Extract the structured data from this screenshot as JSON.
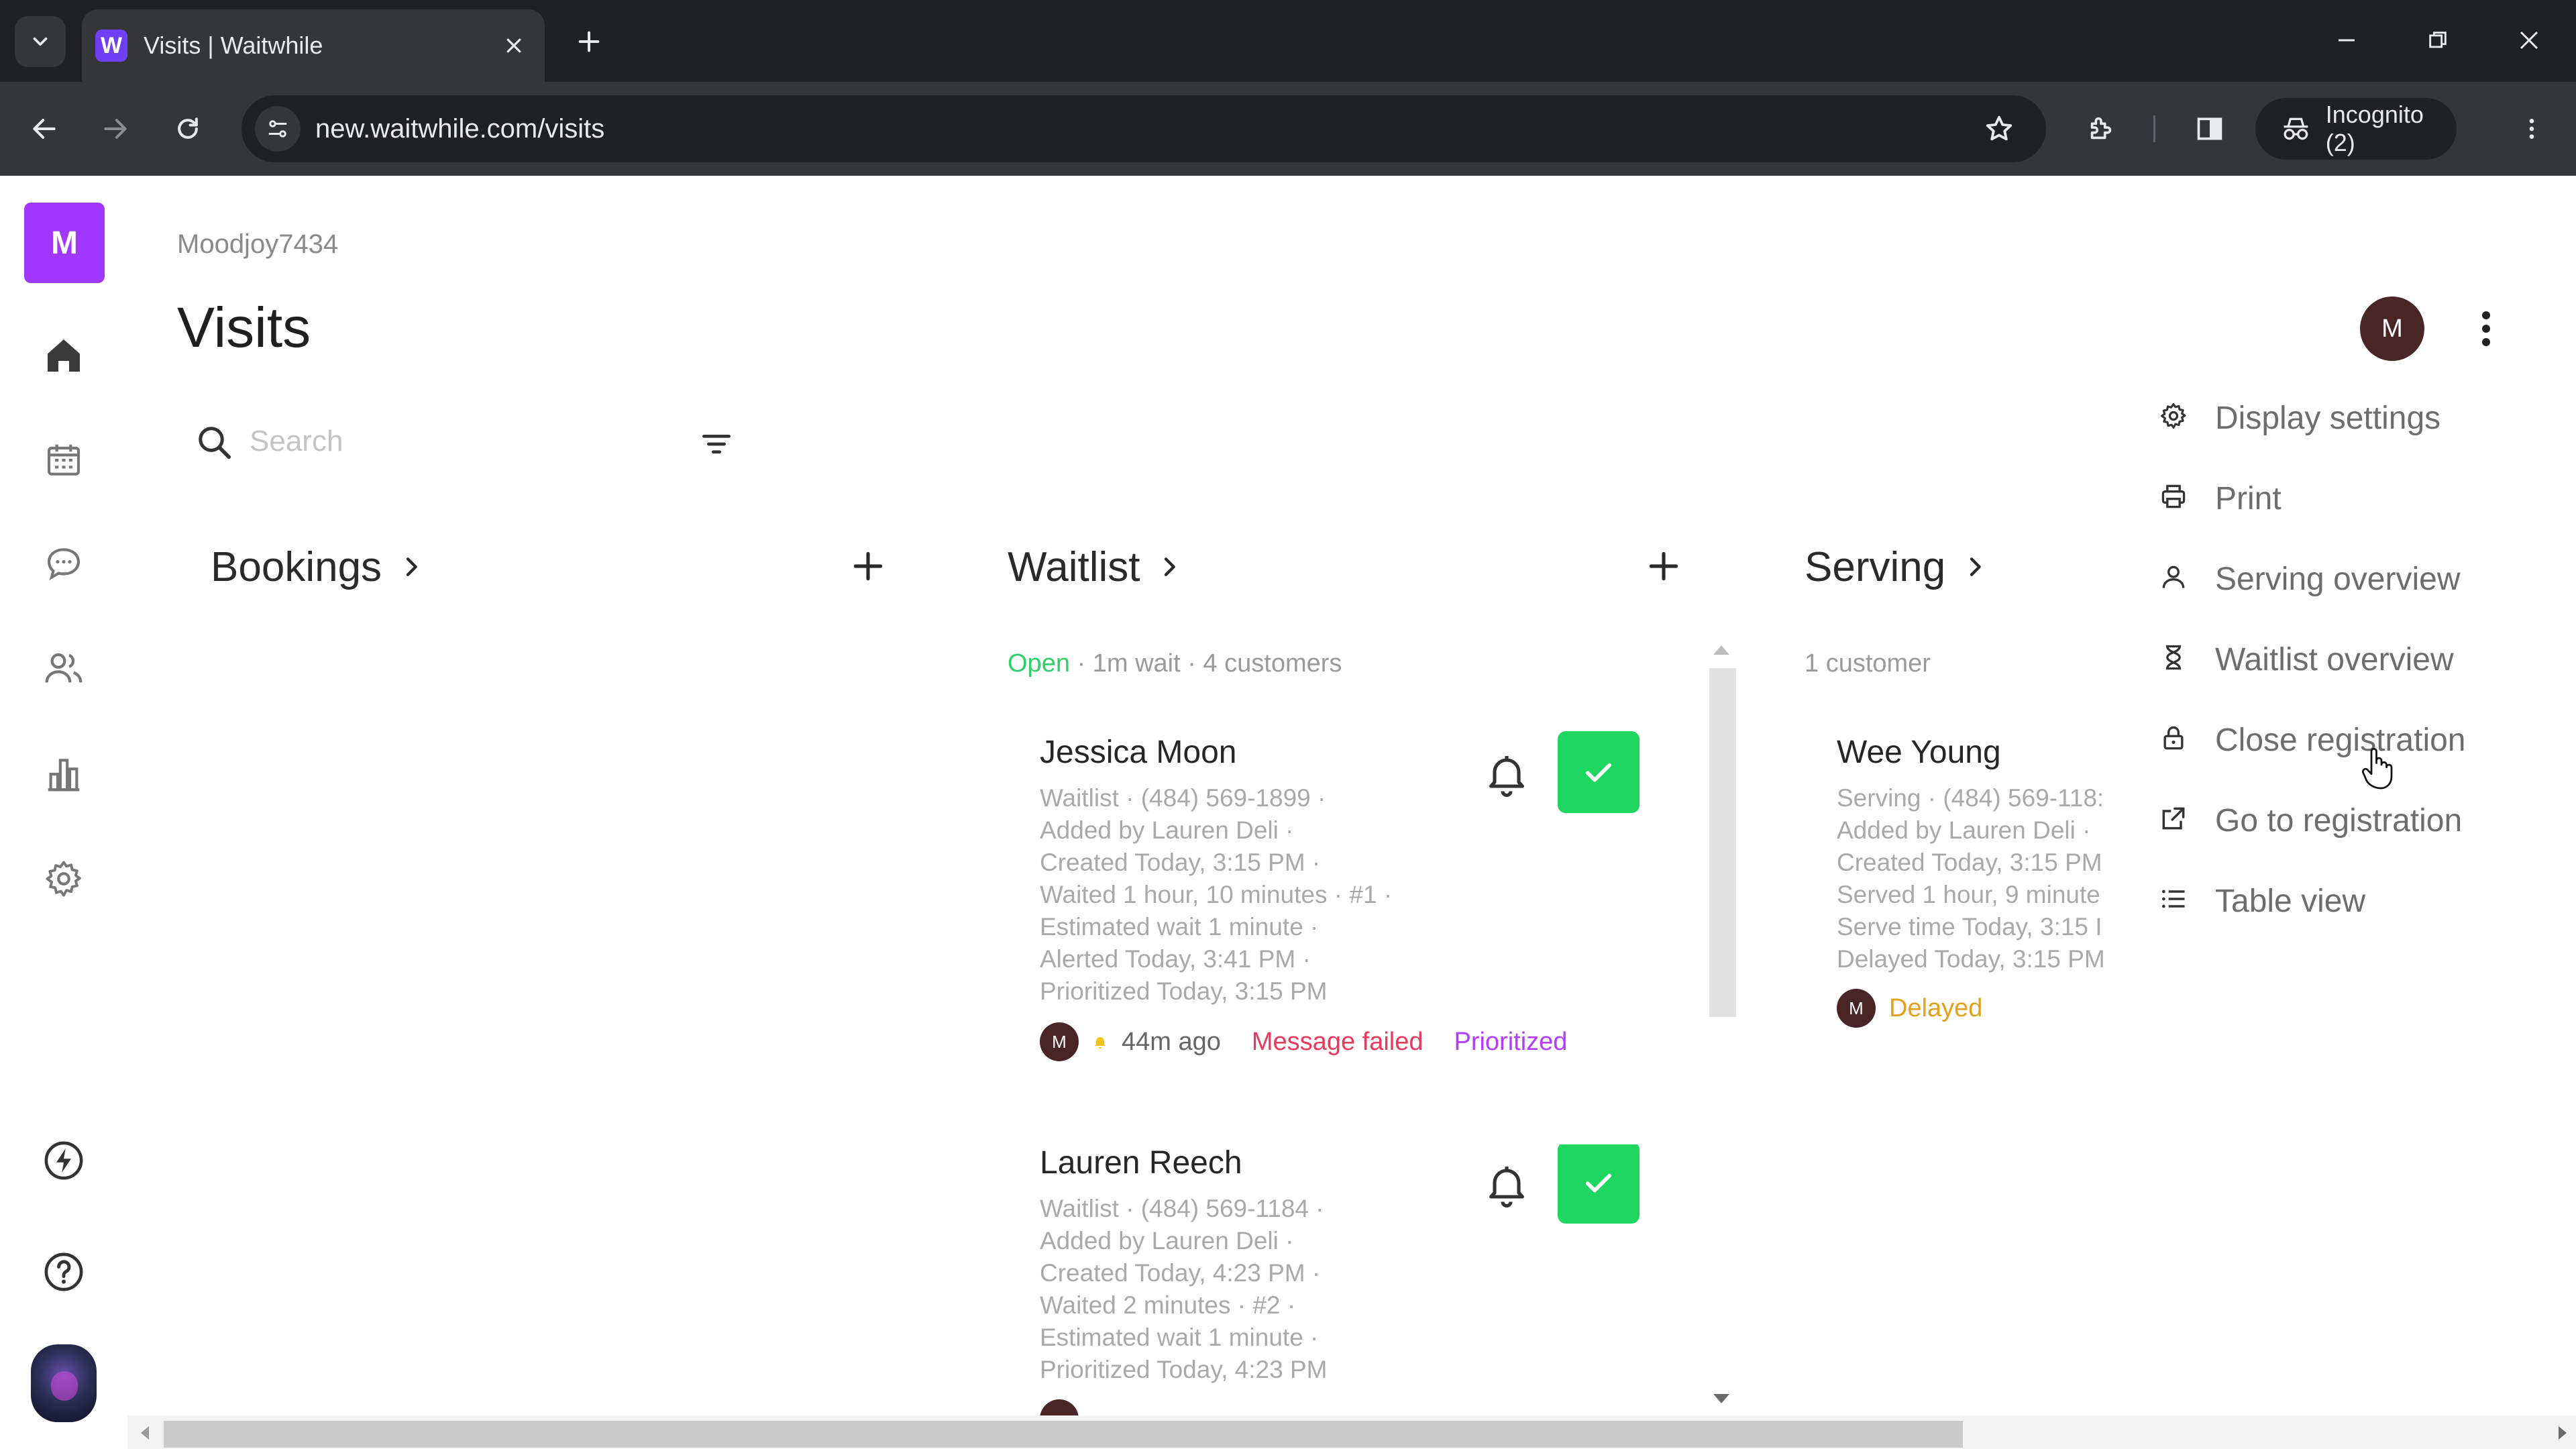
{
  "browser": {
    "tab_title": "Visits | Waitwhile",
    "favicon_letter": "W",
    "url": "new.waitwhile.com/visits",
    "incognito_label": "Incognito (2)"
  },
  "sidebar": {
    "brand_letter": "M",
    "icons": [
      "home-icon",
      "calendar-icon",
      "chat-icon",
      "customers-icon",
      "analytics-icon",
      "settings-icon",
      "bolt-icon",
      "help-icon"
    ]
  },
  "header": {
    "org_name": "Moodjoy7434",
    "title": "Visits",
    "user_initial": "M"
  },
  "search": {
    "placeholder": "Search"
  },
  "columns": {
    "bookings": {
      "title": "Bookings"
    },
    "waitlist": {
      "title": "Waitlist",
      "status": "Open",
      "meta": " · 1m wait · 4 customers"
    },
    "serving": {
      "title": "Serving",
      "meta": "1 customer"
    }
  },
  "waitlist_cards": [
    {
      "name": "Jessica Moon",
      "lines": [
        "Waitlist · (484) 569-1899 ·",
        "Added by Lauren Deli ·",
        "Created Today, 3:15 PM ·",
        "Waited 1 hour, 10 minutes · #1 ·",
        "Estimated wait 1 minute ·",
        "Alerted Today, 3:41 PM ·",
        "Prioritized Today, 3:15 PM"
      ],
      "avatar": "M",
      "alert_ago": "44m ago",
      "message_status": "Message failed",
      "tag": "Prioritized"
    },
    {
      "name": "Lauren Reech",
      "lines": [
        "Waitlist · (484) 569-1184 ·",
        "Added by Lauren Deli ·",
        "Created Today, 4:23 PM ·",
        "Waited 2 minutes · #2 ·",
        "Estimated wait 1 minute ·",
        "Prioritized Today, 4:23 PM"
      ]
    }
  ],
  "serving_card": {
    "name": "Wee Young",
    "lines": [
      "Serving · (484) 569-118:",
      "Added by Lauren Deli ·",
      "Created Today, 3:15 PM",
      "Served 1 hour, 9 minute",
      "Serve time Today, 3:15 I",
      "Delayed Today, 3:15 PM"
    ],
    "avatar": "M",
    "tag": "Delayed"
  },
  "menu": {
    "items": [
      {
        "label": "Display settings",
        "icon": "gear-icon"
      },
      {
        "label": "Print",
        "icon": "printer-icon"
      },
      {
        "label": "Serving overview",
        "icon": "person-icon"
      },
      {
        "label": "Waitlist overview",
        "icon": "hourglass-icon"
      },
      {
        "label": "Close registration",
        "icon": "lock-icon"
      },
      {
        "label": "Go to registration",
        "icon": "external-link-icon"
      },
      {
        "label": "Table view",
        "icon": "list-icon"
      }
    ]
  },
  "colors": {
    "brand": "#a238ff",
    "open": "#2fd16a",
    "check": "#1ed760",
    "failed": "#ea3a5c",
    "prioritized": "#b23cff",
    "delayed": "#e2a21e"
  }
}
